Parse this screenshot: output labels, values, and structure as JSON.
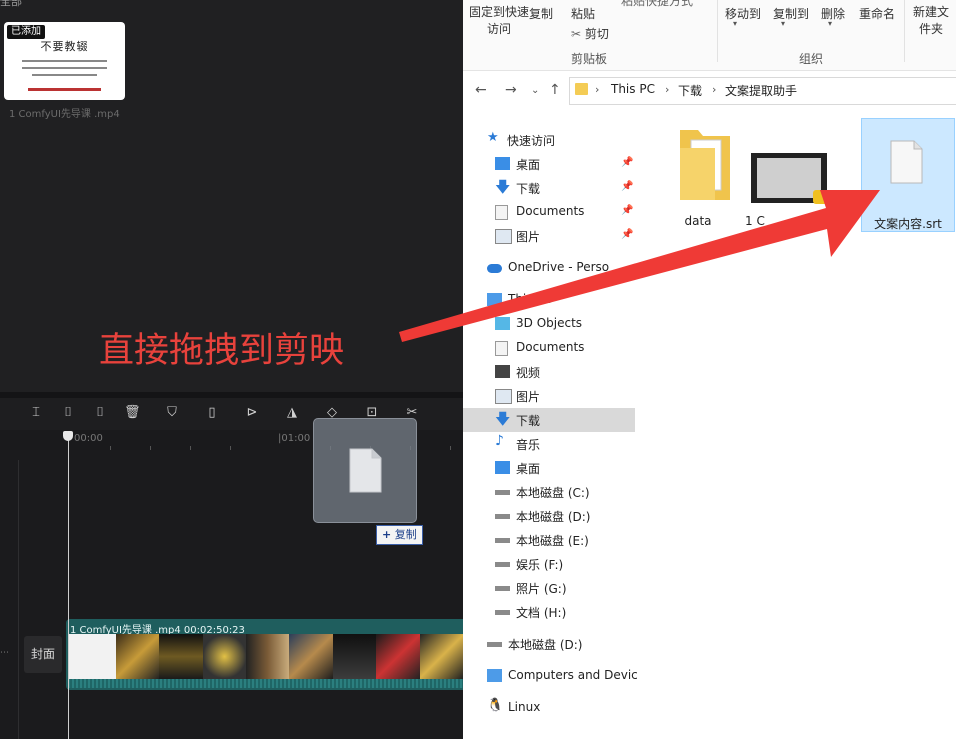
{
  "editor": {
    "top_fragment": "全部",
    "media": {
      "added_badge": "已添加",
      "clip_name": "1 ComfyUI先导课 .mp4",
      "thumb_title": "不要教辍"
    },
    "toolbar_icons": [
      "split-icon",
      "split-left-icon",
      "split-right-icon",
      "delete-icon",
      "marker-icon",
      "freeze-icon",
      "play-circle-icon",
      "mirror-icon",
      "rotate-icon",
      "crop-icon",
      "smart-cut-icon"
    ],
    "ruler": {
      "t0": "00:00",
      "t1": "|01:00"
    },
    "track": {
      "cover_label": "封面",
      "clip_header": "1 ComfyUI先导课 .mp4   00:02:50:23"
    },
    "drag": {
      "copy_label": "复制",
      "copy_icon": "+"
    },
    "annotation": "直接拖拽到剪映"
  },
  "explorer": {
    "ribbon": {
      "pin_quick": "固定到快速访问",
      "copy": "复制",
      "paste": "粘贴",
      "paste_shortcut": "粘贴快捷方式",
      "cut": "剪切",
      "clipboard": "剪贴板",
      "move_to": "移动到",
      "copy_to": "复制到",
      "delete": "删除",
      "rename": "重命名",
      "organize": "组织",
      "new_folder": "新建文件夹"
    },
    "breadcrumb": [
      "This PC",
      "下载",
      "文案提取助手"
    ],
    "nav": {
      "quick_access": "快速访问",
      "quick_items": [
        "桌面",
        "下载",
        "Documents",
        "图片"
      ],
      "onedrive": "OneDrive - Perso",
      "this_pc": "This PC",
      "pc_items": [
        "3D Objects",
        "Documents",
        "视频",
        "图片",
        "下载",
        "音乐",
        "桌面",
        "本地磁盘 (C:)",
        "本地磁盘 (D:)",
        "本地磁盘 (E:)",
        "娱乐 (F:)",
        "照片 (G:)",
        "文档 (H:)"
      ],
      "local_disk": "本地磁盘 (D:)",
      "network": "Computers and Devic",
      "linux": "Linux"
    },
    "files": [
      {
        "name": "data",
        "icon": "folder-icon"
      },
      {
        "name": "1 C",
        "icon": "video-file-icon"
      },
      {
        "name": "文案内容.srt",
        "icon": "document-icon"
      }
    ]
  },
  "colors": {
    "annotation": "#e8423c",
    "arrow": "#ef3a36",
    "selection": "#cce8ff",
    "track": "#1f5e5e"
  }
}
